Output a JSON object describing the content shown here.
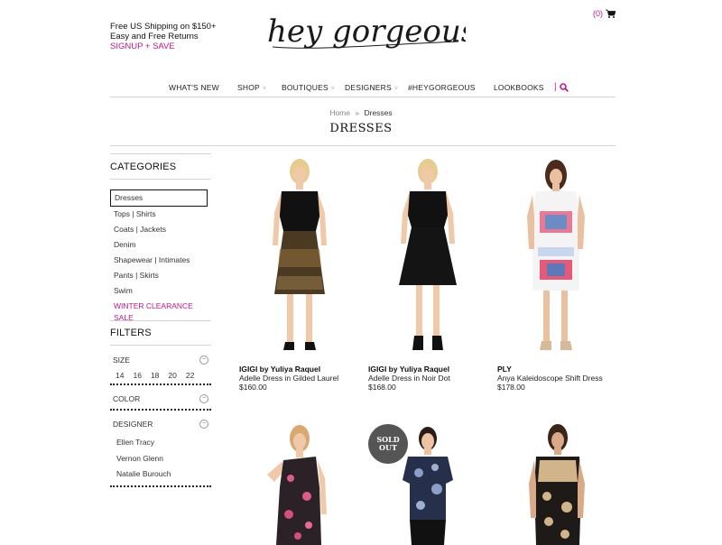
{
  "header": {
    "promo_line1": "Free US Shipping on $150+",
    "promo_line2": "Easy and Free Returns",
    "signup": "SIGNUP + SAVE",
    "logo_text": "hey gorgeous!",
    "cart_count": "(0)"
  },
  "nav": {
    "items": [
      "WHAT'S NEW",
      "SHOP",
      "BOUTIQUES",
      "DESIGNERS",
      "#HEYGORGEOUS",
      "LOOKBOOKS"
    ],
    "caret": "˅",
    "separator": "|"
  },
  "breadcrumb": {
    "home": "Home",
    "sep": "»",
    "current": "Dresses"
  },
  "page_title": "DRESSES",
  "sidebar": {
    "categories_title": "CATEGORIES",
    "categories": [
      "Dresses",
      "Tops | Shirts",
      "Coats | Jackets",
      "Denim",
      "Shapewear | Intimates",
      "Pants | Skirts",
      "Swim",
      "WINTER CLEARANCE SALE"
    ],
    "filters_title": "FILTERS",
    "size_label": "SIZE",
    "sizes": [
      "14",
      "16",
      "18",
      "20",
      "22"
    ],
    "color_label": "COLOR",
    "designer_label": "DESIGNER",
    "designers": [
      "Ellen Tracy",
      "Vernon Glenn",
      "Natalie Burouch"
    ],
    "collapse_symbol": "−"
  },
  "products": [
    {
      "brand": "IGIGI by Yuliya Raquel",
      "name": "Adelle Dress in Gilded Laurel",
      "price": "$160.00"
    },
    {
      "brand": "IGIGI by Yuliya Raquel",
      "name": "Adelle Dress in Noir Dot",
      "price": "$168.00"
    },
    {
      "brand": "PLY",
      "name": "Anya Kaleidoscope Shift Dress",
      "price": "$178.00"
    }
  ],
  "sold_out": {
    "line1": "SOLD",
    "line2": "OUT"
  },
  "colors": {
    "accent": "#c0178a",
    "text": "#222222",
    "divider": "#d4d4d4"
  }
}
